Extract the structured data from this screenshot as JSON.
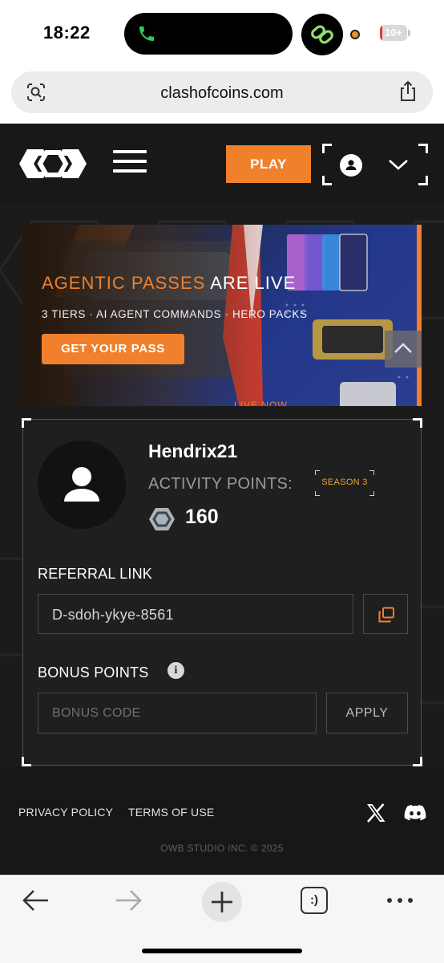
{
  "status_bar": {
    "time": "18:22",
    "battery_text": "10+",
    "battery_level_percent": 10
  },
  "browser": {
    "url": "clashofcoins.com",
    "tabs_icon_text": ":)"
  },
  "header": {
    "play_label": "PLAY"
  },
  "banner": {
    "title_highlight": "AGENTIC PASSES",
    "title_rest": " ARE LIVE",
    "subtitle": "3 TIERS · AI AGENT COMMANDS · HERO PACKS",
    "cta_label": "GET YOUR PASS",
    "bottom_text": "LIVE NOW"
  },
  "profile": {
    "username": "Hendrix21",
    "activity_points_label": "ACTIVITY POINTS:",
    "season_label": "SEASON 3",
    "points": "160",
    "referral_label": "REFERRAL LINK",
    "referral_code": "D-sdoh-ykye-8561",
    "bonus_label": "BONUS POINTS",
    "bonus_placeholder": "BONUS CODE",
    "apply_label": "APPLY"
  },
  "footer": {
    "privacy": "PRIVACY POLICY",
    "terms": "TERMS OF USE",
    "copyright": "OWB STUDIO INC. © 2025"
  },
  "colors": {
    "accent": "#f0802c",
    "site_bg": "#1b1b1c",
    "card_bg": "#1f1f20",
    "call_green": "#34c759"
  }
}
